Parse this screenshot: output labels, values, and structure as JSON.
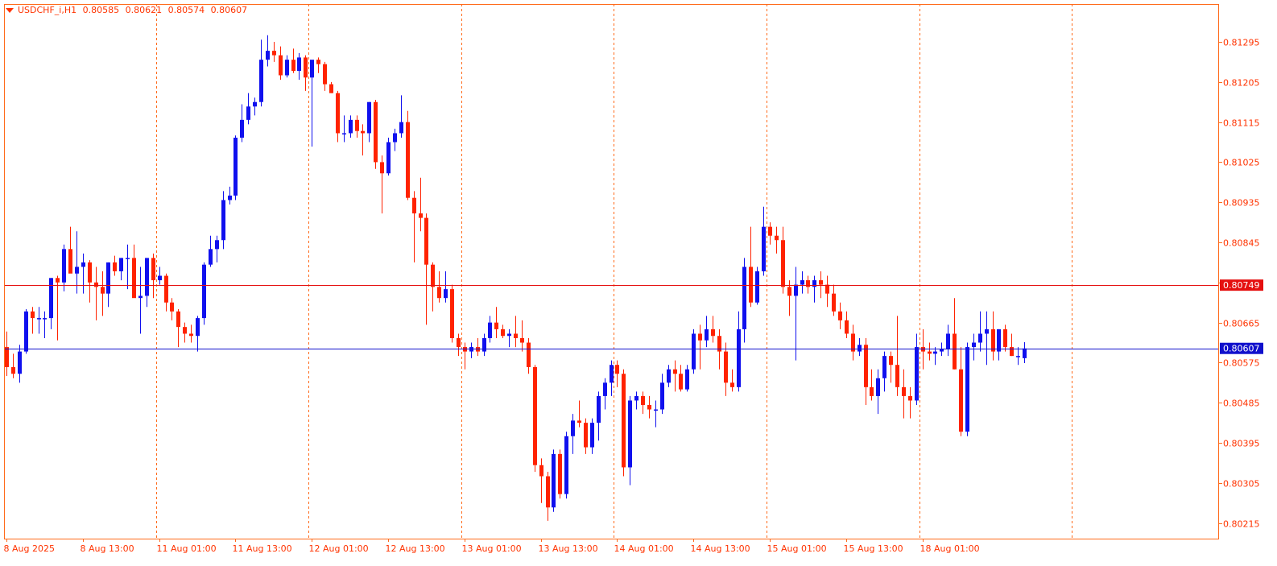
{
  "header": {
    "symbol_timeframe": "USDCHF_i,H1",
    "open": "0.80585",
    "high": "0.80621",
    "low": "0.80574",
    "close": "0.80607"
  },
  "colors": {
    "background": "#ffffff",
    "frame": "#ff6a1a",
    "bull": "#1010ee",
    "bear": "#ff2200",
    "axis_text": "#ff3300",
    "grid_vertical": "#ff6a1a",
    "hline_red": "#e51010",
    "hline_blue": "#1010cc"
  },
  "chart_data": {
    "type": "candlestick",
    "timeframe": "H1",
    "y_range": [
      0.8018,
      0.8138
    ],
    "y_ticks": [
      "0.81295",
      "0.81205",
      "0.81115",
      "0.81025",
      "0.80935",
      "0.80845",
      "0.80755",
      "0.80665",
      "0.80575",
      "0.80485",
      "0.80395",
      "0.80305",
      "0.80215"
    ],
    "x_tick_labels": [
      "8 Aug 2025",
      "8 Aug 13:00",
      "11 Aug 01:00",
      "11 Aug 13:00",
      "12 Aug 01:00",
      "12 Aug 13:00",
      "13 Aug 01:00",
      "13 Aug 13:00",
      "14 Aug 01:00",
      "14 Aug 13:00",
      "15 Aug 01:00",
      "15 Aug 13:00",
      "18 Aug 01:00"
    ],
    "x_tick_bars": [
      0,
      12,
      24,
      36,
      48,
      60,
      72,
      84,
      96,
      108,
      120,
      132,
      144
    ],
    "day_separator_bars": [
      23,
      47,
      71,
      95,
      119,
      143,
      167
    ],
    "grid": "vertical-dotted",
    "horizontal_lines": [
      {
        "price": 0.80749,
        "label": "0.80749",
        "color": "#e51010"
      },
      {
        "price": 0.80607,
        "label": "0.80607",
        "color": "#1010cc"
      }
    ],
    "candles": [
      [
        0.8061,
        0.80645,
        0.80545,
        0.80565
      ],
      [
        0.80565,
        0.80595,
        0.8054,
        0.8055
      ],
      [
        0.8055,
        0.80615,
        0.8053,
        0.806
      ],
      [
        0.806,
        0.80695,
        0.80595,
        0.8069
      ],
      [
        0.8069,
        0.807,
        0.8064,
        0.80675
      ],
      [
        0.80675,
        0.807,
        0.8064,
        0.80675
      ],
      [
        0.80675,
        0.8069,
        0.8063,
        0.80675
      ],
      [
        0.80675,
        0.80765,
        0.8065,
        0.80765
      ],
      [
        0.80765,
        0.8077,
        0.80625,
        0.80755
      ],
      [
        0.80755,
        0.8084,
        0.80735,
        0.8083
      ],
      [
        0.8083,
        0.8088,
        0.8079,
        0.80775
      ],
      [
        0.80775,
        0.8087,
        0.8073,
        0.8079
      ],
      [
        0.8079,
        0.8082,
        0.8073,
        0.808
      ],
      [
        0.808,
        0.80805,
        0.8071,
        0.80755
      ],
      [
        0.80755,
        0.8079,
        0.8067,
        0.80745
      ],
      [
        0.80745,
        0.8078,
        0.8068,
        0.8073
      ],
      [
        0.8073,
        0.808,
        0.807,
        0.808
      ],
      [
        0.808,
        0.80815,
        0.8077,
        0.8078
      ],
      [
        0.8078,
        0.8081,
        0.8076,
        0.8081
      ],
      [
        0.8081,
        0.8084,
        0.8074,
        0.8081
      ],
      [
        0.8081,
        0.8084,
        0.8074,
        0.8072
      ],
      [
        0.8072,
        0.8079,
        0.8064,
        0.80725
      ],
      [
        0.80725,
        0.8081,
        0.807,
        0.8081
      ],
      [
        0.8081,
        0.8082,
        0.8072,
        0.8076
      ],
      [
        0.8076,
        0.8079,
        0.8075,
        0.8077
      ],
      [
        0.8077,
        0.80775,
        0.8069,
        0.8071
      ],
      [
        0.8071,
        0.8072,
        0.8067,
        0.8069
      ],
      [
        0.8069,
        0.80695,
        0.8061,
        0.80655
      ],
      [
        0.80655,
        0.80665,
        0.8062,
        0.8064
      ],
      [
        0.8064,
        0.8066,
        0.8062,
        0.80635
      ],
      [
        0.80635,
        0.8068,
        0.806,
        0.80675
      ],
      [
        0.80675,
        0.808,
        0.8066,
        0.80795
      ],
      [
        0.80795,
        0.8086,
        0.8079,
        0.8083
      ],
      [
        0.8083,
        0.8086,
        0.808,
        0.8085
      ],
      [
        0.8085,
        0.8096,
        0.8083,
        0.8094
      ],
      [
        0.8094,
        0.8097,
        0.8093,
        0.8095
      ],
      [
        0.8095,
        0.81085,
        0.8094,
        0.8108
      ],
      [
        0.8108,
        0.81155,
        0.8107,
        0.8112
      ],
      [
        0.8112,
        0.8118,
        0.8111,
        0.8115
      ],
      [
        0.8115,
        0.8117,
        0.8113,
        0.8116
      ],
      [
        0.8116,
        0.813,
        0.8115,
        0.81255
      ],
      [
        0.81255,
        0.8131,
        0.8124,
        0.81275
      ],
      [
        0.81275,
        0.81295,
        0.8125,
        0.81265
      ],
      [
        0.81265,
        0.81285,
        0.8121,
        0.8122
      ],
      [
        0.8122,
        0.81265,
        0.81215,
        0.81255
      ],
      [
        0.81255,
        0.8128,
        0.81225,
        0.8123
      ],
      [
        0.8123,
        0.8127,
        0.8121,
        0.8126
      ],
      [
        0.8126,
        0.81265,
        0.81185,
        0.81215
      ],
      [
        0.81215,
        0.8123,
        0.8106,
        0.81255
      ],
      [
        0.81255,
        0.8126,
        0.81225,
        0.81245
      ],
      [
        0.81245,
        0.8125,
        0.81185,
        0.812
      ],
      [
        0.812,
        0.81205,
        0.8118,
        0.8118
      ],
      [
        0.8118,
        0.81185,
        0.8107,
        0.8109
      ],
      [
        0.8109,
        0.8113,
        0.8107,
        0.8109
      ],
      [
        0.8109,
        0.8113,
        0.8108,
        0.8112
      ],
      [
        0.8112,
        0.8113,
        0.8108,
        0.81095
      ],
      [
        0.81095,
        0.8111,
        0.8104,
        0.8109
      ],
      [
        0.8109,
        0.8116,
        0.8107,
        0.8116
      ],
      [
        0.8116,
        0.81165,
        0.8101,
        0.81025
      ],
      [
        0.81025,
        0.8104,
        0.8091,
        0.81
      ],
      [
        0.81,
        0.8108,
        0.80995,
        0.8107
      ],
      [
        0.8107,
        0.811,
        0.8105,
        0.8109
      ],
      [
        0.8109,
        0.81175,
        0.8108,
        0.81115
      ],
      [
        0.81115,
        0.8114,
        0.8094,
        0.80945
      ],
      [
        0.80945,
        0.8096,
        0.808,
        0.8091
      ],
      [
        0.8091,
        0.8099,
        0.8087,
        0.809
      ],
      [
        0.809,
        0.8091,
        0.8066,
        0.80795
      ],
      [
        0.80795,
        0.808,
        0.8069,
        0.80745
      ],
      [
        0.80745,
        0.8078,
        0.8071,
        0.8072
      ],
      [
        0.8072,
        0.8078,
        0.8071,
        0.8074
      ],
      [
        0.8074,
        0.8075,
        0.8062,
        0.8063
      ],
      [
        0.8063,
        0.8064,
        0.8059,
        0.8061
      ],
      [
        0.8061,
        0.8062,
        0.8056,
        0.806
      ],
      [
        0.806,
        0.8062,
        0.80585,
        0.8061
      ],
      [
        0.8061,
        0.8063,
        0.8059,
        0.806
      ],
      [
        0.806,
        0.8064,
        0.8059,
        0.8063
      ],
      [
        0.8063,
        0.8068,
        0.8062,
        0.80665
      ],
      [
        0.80665,
        0.807,
        0.8063,
        0.8065
      ],
      [
        0.8065,
        0.8066,
        0.8063,
        0.80635
      ],
      [
        0.80635,
        0.8065,
        0.8061,
        0.8064
      ],
      [
        0.8064,
        0.8068,
        0.8061,
        0.8063
      ],
      [
        0.8063,
        0.8067,
        0.806,
        0.8062
      ],
      [
        0.8062,
        0.8063,
        0.8055,
        0.80565
      ],
      [
        0.80565,
        0.8057,
        0.8033,
        0.80345
      ],
      [
        0.80345,
        0.8036,
        0.8026,
        0.8032
      ],
      [
        0.8032,
        0.8033,
        0.8022,
        0.8025
      ],
      [
        0.8025,
        0.8038,
        0.8024,
        0.8037
      ],
      [
        0.8037,
        0.8038,
        0.8027,
        0.8028
      ],
      [
        0.8028,
        0.8042,
        0.8027,
        0.8041
      ],
      [
        0.8041,
        0.8046,
        0.8037,
        0.80445
      ],
      [
        0.80445,
        0.8049,
        0.8043,
        0.8044
      ],
      [
        0.8044,
        0.8045,
        0.8037,
        0.80385
      ],
      [
        0.80385,
        0.8045,
        0.8037,
        0.8044
      ],
      [
        0.8044,
        0.8051,
        0.804,
        0.805
      ],
      [
        0.805,
        0.8054,
        0.8047,
        0.8053
      ],
      [
        0.8053,
        0.8058,
        0.805,
        0.8057
      ],
      [
        0.8057,
        0.8058,
        0.8052,
        0.8055
      ],
      [
        0.8055,
        0.8056,
        0.8032,
        0.8034
      ],
      [
        0.8034,
        0.805,
        0.803,
        0.8049
      ],
      [
        0.8049,
        0.8051,
        0.8047,
        0.805
      ],
      [
        0.805,
        0.8051,
        0.8046,
        0.8048
      ],
      [
        0.8048,
        0.805,
        0.8045,
        0.8047
      ],
      [
        0.8047,
        0.8049,
        0.8043,
        0.8047
      ],
      [
        0.8047,
        0.8055,
        0.8046,
        0.8053
      ],
      [
        0.8053,
        0.8057,
        0.8052,
        0.8056
      ],
      [
        0.8056,
        0.8058,
        0.8051,
        0.8055
      ],
      [
        0.8055,
        0.8057,
        0.8051,
        0.80515
      ],
      [
        0.80515,
        0.8057,
        0.8051,
        0.8056
      ],
      [
        0.8056,
        0.8065,
        0.8055,
        0.8064
      ],
      [
        0.8064,
        0.8066,
        0.8056,
        0.80625
      ],
      [
        0.80625,
        0.8068,
        0.8061,
        0.8065
      ],
      [
        0.8065,
        0.8068,
        0.8062,
        0.80635
      ],
      [
        0.80635,
        0.8065,
        0.8056,
        0.806
      ],
      [
        0.806,
        0.8062,
        0.805,
        0.8053
      ],
      [
        0.8053,
        0.8056,
        0.8051,
        0.8052
      ],
      [
        0.8052,
        0.8069,
        0.8051,
        0.8065
      ],
      [
        0.8065,
        0.8081,
        0.8062,
        0.8079
      ],
      [
        0.8079,
        0.8088,
        0.807,
        0.8071
      ],
      [
        0.8071,
        0.8079,
        0.80705,
        0.8078
      ],
      [
        0.8078,
        0.80925,
        0.8077,
        0.8088
      ],
      [
        0.8088,
        0.8089,
        0.8084,
        0.8086
      ],
      [
        0.8086,
        0.8088,
        0.8082,
        0.8085
      ],
      [
        0.8085,
        0.8088,
        0.8073,
        0.80745
      ],
      [
        0.80745,
        0.8076,
        0.8068,
        0.80725
      ],
      [
        0.80725,
        0.8079,
        0.8058,
        0.8075
      ],
      [
        0.8075,
        0.8078,
        0.8073,
        0.8076
      ],
      [
        0.8076,
        0.8077,
        0.8073,
        0.80745
      ],
      [
        0.80745,
        0.8077,
        0.8071,
        0.8076
      ],
      [
        0.8076,
        0.8078,
        0.8072,
        0.8075
      ],
      [
        0.8075,
        0.8077,
        0.807,
        0.8073
      ],
      [
        0.8073,
        0.8075,
        0.8068,
        0.8069
      ],
      [
        0.8069,
        0.8071,
        0.8065,
        0.8067
      ],
      [
        0.8067,
        0.8069,
        0.8063,
        0.8064
      ],
      [
        0.8064,
        0.8066,
        0.8058,
        0.806
      ],
      [
        0.806,
        0.8063,
        0.8059,
        0.80615
      ],
      [
        0.80615,
        0.8063,
        0.8048,
        0.8052
      ],
      [
        0.8052,
        0.8056,
        0.8049,
        0.805
      ],
      [
        0.805,
        0.8056,
        0.8046,
        0.8054
      ],
      [
        0.8054,
        0.806,
        0.8051,
        0.8059
      ],
      [
        0.8059,
        0.806,
        0.8053,
        0.8057
      ],
      [
        0.8057,
        0.8068,
        0.805,
        0.8052
      ],
      [
        0.8052,
        0.8056,
        0.8045,
        0.805
      ],
      [
        0.805,
        0.8052,
        0.8045,
        0.8049
      ],
      [
        0.8049,
        0.8064,
        0.8048,
        0.8061
      ],
      [
        0.8061,
        0.8065,
        0.8056,
        0.806
      ],
      [
        0.806,
        0.8062,
        0.8058,
        0.80595
      ],
      [
        0.80595,
        0.8061,
        0.8057,
        0.806
      ],
      [
        0.806,
        0.8062,
        0.8059,
        0.80605
      ],
      [
        0.80605,
        0.8066,
        0.8059,
        0.8064
      ],
      [
        0.8064,
        0.8072,
        0.8056,
        0.8056
      ],
      [
        0.8056,
        0.8061,
        0.8041,
        0.8042
      ],
      [
        0.8042,
        0.8062,
        0.8041,
        0.8061
      ],
      [
        0.8061,
        0.8064,
        0.8058,
        0.8062
      ],
      [
        0.8062,
        0.8069,
        0.806,
        0.8064
      ],
      [
        0.8064,
        0.8069,
        0.8057,
        0.8065
      ],
      [
        0.8065,
        0.8069,
        0.8058,
        0.806
      ],
      [
        0.806,
        0.8065,
        0.8058,
        0.8065
      ],
      [
        0.8065,
        0.8066,
        0.806,
        0.8061
      ],
      [
        0.8061,
        0.8064,
        0.8059,
        0.8059
      ],
      [
        0.8059,
        0.8061,
        0.8057,
        0.8059
      ],
      [
        0.80585,
        0.80621,
        0.80574,
        0.80607
      ]
    ]
  }
}
